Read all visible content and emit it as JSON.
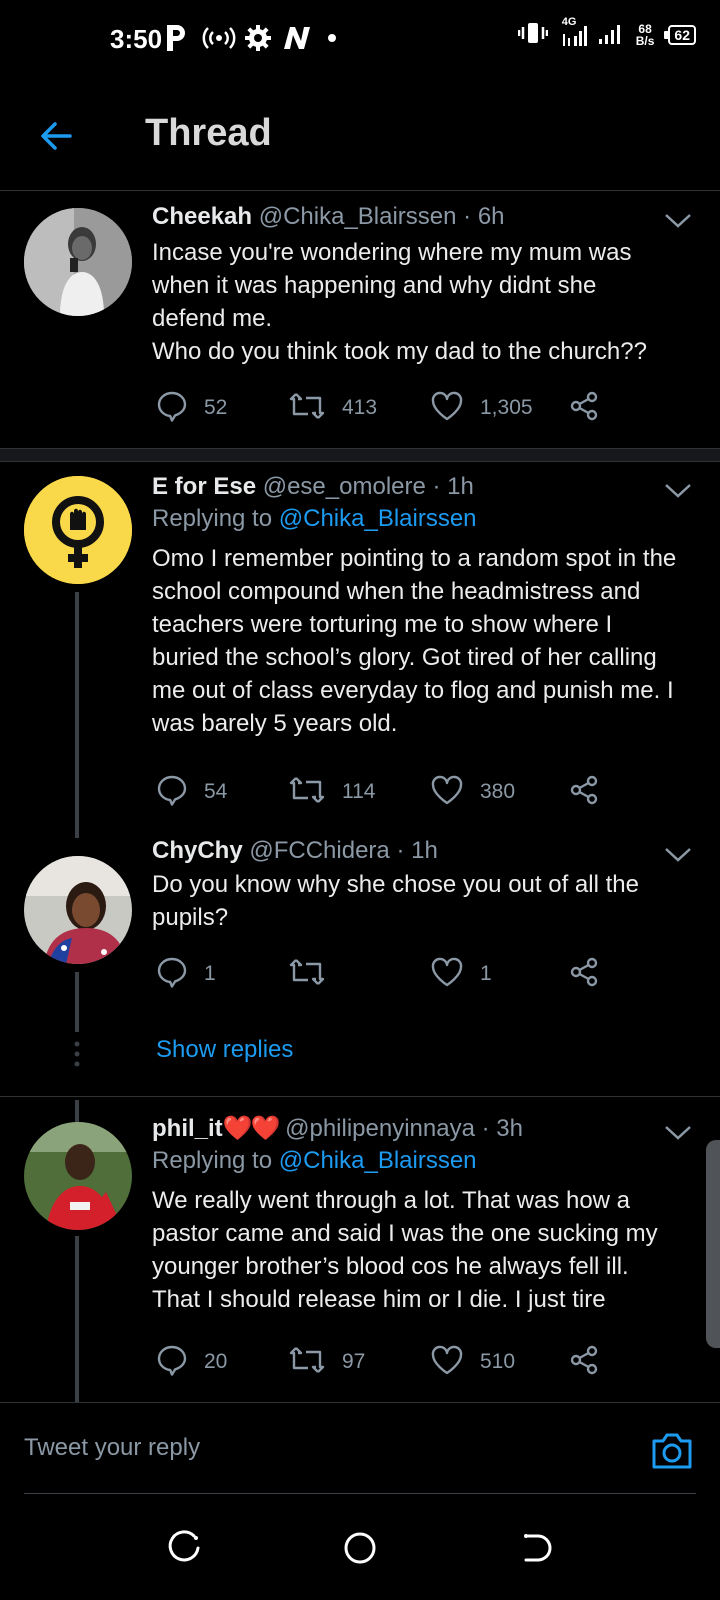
{
  "status_bar": {
    "time": "3:50",
    "network_type": "4G",
    "speed_value": "68",
    "speed_unit": "B/s",
    "battery": "62"
  },
  "header": {
    "title": "Thread"
  },
  "tweets": [
    {
      "name": "Cheekah",
      "handle": "@Chika_Blairssen",
      "time": "· 6h",
      "replying_prefix": "",
      "replying_to": "",
      "lines": [
        "Incase you're wondering where my mum was",
        "when it was happening and why didnt she",
        "defend me.",
        "Who do you think took my dad to the church??"
      ],
      "replies": "52",
      "retweets": "413",
      "likes": "1,305"
    },
    {
      "name": "E for Ese",
      "handle": "@ese_omolere",
      "time": "· 1h",
      "replying_prefix": "Replying to ",
      "replying_to": "@Chika_Blairssen",
      "lines": [
        "Omo I remember pointing to a random spot in the",
        "school compound when the headmistress and",
        "teachers were torturing me to show where I",
        "buried the school’s glory. Got tired of her calling",
        "me out of class everyday to flog and punish me. I",
        "was barely 5 years old."
      ],
      "replies": "54",
      "retweets": "114",
      "likes": "380"
    },
    {
      "name": "ChyChy",
      "handle": "@FCChidera",
      "time": "· 1h",
      "replying_prefix": "",
      "replying_to": "",
      "lines": [
        "Do you know why she chose you out of all the",
        "pupils?"
      ],
      "replies": "1",
      "retweets": "",
      "likes": "1"
    },
    {
      "name": "phil_it",
      "name_emoji": "❤️❤️",
      "handle": "@philipenyinnaya",
      "time": "· 3h",
      "replying_prefix": "Replying to ",
      "replying_to": "@Chika_Blairssen",
      "lines": [
        "We really went through a lot. That was how a",
        "pastor came and said I was the one sucking my",
        "younger brother’s blood cos he always fell ill.",
        "That I should release him or I die. I just tire"
      ],
      "replies": "20",
      "retweets": "97",
      "likes": "510"
    }
  ],
  "show_replies": "Show replies",
  "reply_bar": {
    "placeholder": "Tweet your reply"
  },
  "colors": {
    "accent": "#1d9bf0",
    "background": "#000000",
    "muted": "#8b98a5",
    "divider": "#2f3336",
    "avatar_ese": "#f9d84a"
  },
  "icons": [
    "back-arrow-icon",
    "reply-icon",
    "retweet-icon",
    "like-icon",
    "share-icon",
    "caret-down-icon",
    "camera-icon"
  ]
}
